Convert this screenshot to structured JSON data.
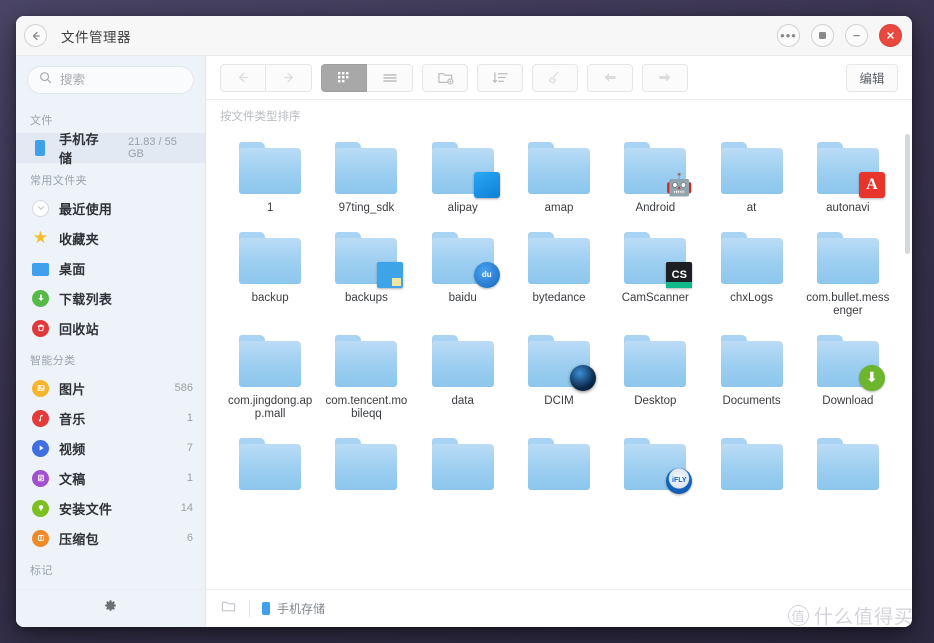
{
  "window": {
    "title": "文件管理器",
    "back_icon": "back-arrow-icon",
    "controls": {
      "more_label": "···",
      "maximize_label": "maximize-icon",
      "minimize_label": "minimize-icon",
      "close_label": "close-icon"
    }
  },
  "search": {
    "placeholder": "搜索",
    "value": "",
    "icon": "search-icon"
  },
  "sidebar": {
    "groups": [
      {
        "title": "文件",
        "items": [
          {
            "label": "手机存储",
            "meta": "21.83 / 55 GB",
            "icon": "phone-storage-icon",
            "selected": true
          }
        ]
      },
      {
        "title": "常用文件夹",
        "items": [
          {
            "label": "最近使用",
            "meta": "",
            "icon": "recent-clock-icon",
            "selected": false
          },
          {
            "label": "收藏夹",
            "meta": "",
            "icon": "star-icon",
            "selected": false
          },
          {
            "label": "桌面",
            "meta": "",
            "icon": "desktop-icon",
            "selected": false
          },
          {
            "label": "下载列表",
            "meta": "",
            "icon": "download-icon",
            "selected": false
          },
          {
            "label": "回收站",
            "meta": "",
            "icon": "trash-icon",
            "selected": false
          }
        ]
      },
      {
        "title": "智能分类",
        "items": [
          {
            "label": "图片",
            "meta": "586",
            "icon": "picture-icon",
            "selected": false
          },
          {
            "label": "音乐",
            "meta": "1",
            "icon": "music-note-icon",
            "selected": false
          },
          {
            "label": "视频",
            "meta": "7",
            "icon": "video-play-icon",
            "selected": false
          },
          {
            "label": "文稿",
            "meta": "1",
            "icon": "document-icon",
            "selected": false
          },
          {
            "label": "安装文件",
            "meta": "14",
            "icon": "apk-package-icon",
            "selected": false
          },
          {
            "label": "压缩包",
            "meta": "6",
            "icon": "archive-zip-icon",
            "selected": false
          }
        ]
      },
      {
        "title": "标记",
        "items": []
      }
    ]
  },
  "toolbar": {
    "back_icon": "back-arrow-icon",
    "forward_icon": "forward-arrow-icon",
    "grid_view_icon": "grid-view-icon",
    "list_view_icon": "list-view-icon",
    "new_folder_icon": "new-folder-icon",
    "sort_icon": "sort-icon",
    "clean_icon": "broom-clean-icon",
    "undo_icon": "undo-icon",
    "redo_icon": "redo-icon",
    "edit_label": "编辑"
  },
  "content": {
    "sort_label": "按文件类型排序",
    "files": [
      {
        "name": "1",
        "badge": ""
      },
      {
        "name": "97ting_sdk",
        "badge": ""
      },
      {
        "name": "alipay",
        "badge": "alipay"
      },
      {
        "name": "amap",
        "badge": ""
      },
      {
        "name": "Android",
        "badge": "android"
      },
      {
        "name": "at",
        "badge": ""
      },
      {
        "name": "autonavi",
        "badge": "autonavi"
      },
      {
        "name": "backup",
        "badge": ""
      },
      {
        "name": "backups",
        "badge": "bookmark"
      },
      {
        "name": "baidu",
        "badge": "baidu"
      },
      {
        "name": "bytedance",
        "badge": ""
      },
      {
        "name": "CamScanner",
        "badge": "camscanner"
      },
      {
        "name": "chxLogs",
        "badge": ""
      },
      {
        "name": "com.bullet.messenger",
        "badge": ""
      },
      {
        "name": "com.jingdong.app.mall",
        "badge": ""
      },
      {
        "name": "com.tencent.mobileqq",
        "badge": ""
      },
      {
        "name": "data",
        "badge": ""
      },
      {
        "name": "DCIM",
        "badge": "dcim"
      },
      {
        "name": "Desktop",
        "badge": ""
      },
      {
        "name": "Documents",
        "badge": ""
      },
      {
        "name": "Download",
        "badge": "download"
      },
      {
        "name": "",
        "badge": ""
      },
      {
        "name": "",
        "badge": ""
      },
      {
        "name": "",
        "badge": ""
      },
      {
        "name": "",
        "badge": ""
      },
      {
        "name": "",
        "badge": "ifly"
      },
      {
        "name": "",
        "badge": ""
      },
      {
        "name": "",
        "badge": ""
      }
    ],
    "badge_text": {
      "baidu": "du",
      "camscanner": "CS",
      "autonavi": "A",
      "ifly": "iFLY"
    }
  },
  "statusbar": {
    "settings_icon": "gear-icon",
    "folder_icon": "folder-icon",
    "path_label": "手机存储"
  },
  "watermark": {
    "mark": "值",
    "text": "什么值得买"
  },
  "colors": {
    "accent_blue": "#3fa0ee",
    "folder_blue": "#9ccef0",
    "close_red": "#e8483f",
    "sidebar_bg": "#eef3fa",
    "selected_bg": "#e2e9f3"
  }
}
